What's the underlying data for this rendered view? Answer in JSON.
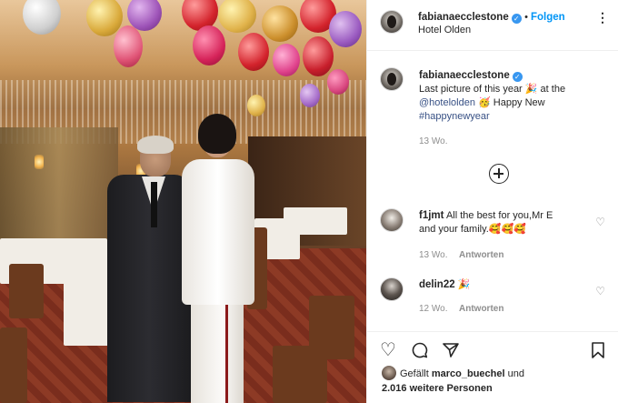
{
  "post": {
    "author": "fabianaecclestone",
    "follow_label": "Folgen",
    "location": "Hotel Olden",
    "more_icon": "more-options-icon",
    "caption": {
      "text_part1": "Last picture of this year ",
      "emoji1": "🎉",
      "text_part2": " at the",
      "mention": "@hotelolden",
      "emoji2": "🥳",
      "text_part3": " Happy New",
      "hashtag": "#happynewyear",
      "time": "13 Wo."
    },
    "add_more_icon": "plus-circle-icon",
    "comments": [
      {
        "user": "f1jmt",
        "text_line1": "All the best for you,Mr E",
        "text_line2": "and your family.",
        "emojis": "🥰🥰🥰",
        "time": "13 Wo.",
        "reply": "Antworten"
      },
      {
        "user": "delin22",
        "emojis": "🎉",
        "time": "12 Wo.",
        "reply": "Antworten"
      }
    ],
    "likes": {
      "prefix": "Gefällt",
      "user": "marco_buechel",
      "middle": "und",
      "count": "2.016 weitere Personen"
    }
  },
  "colors": {
    "accent": "#0095f6",
    "verified": "#3897f0",
    "link": "#385185",
    "muted": "#8e8e8e"
  }
}
